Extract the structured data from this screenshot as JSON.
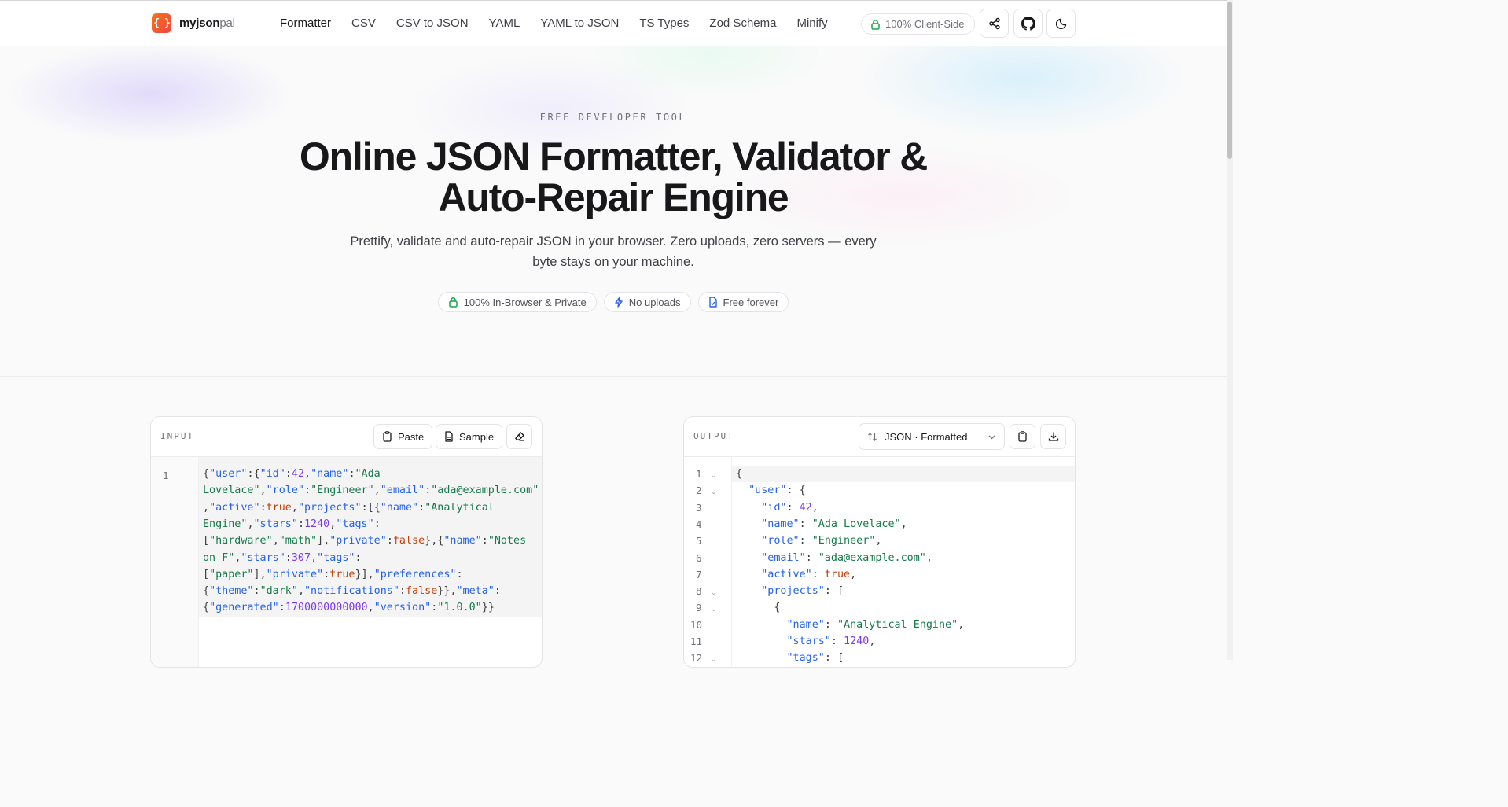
{
  "brand": {
    "name_bold": "myjson",
    "name_light": "pal"
  },
  "nav": {
    "items": [
      "Formatter",
      "CSV",
      "CSV to JSON",
      "YAML",
      "YAML to JSON",
      "TS Types",
      "Zod Schema",
      "Minify"
    ],
    "active": "Formatter"
  },
  "header_badge": "100% Client-Side",
  "header_icons": [
    "share-icon",
    "github-icon",
    "moon-icon"
  ],
  "hero": {
    "eyebrow": "FREE DEVELOPER TOOL",
    "title_line1": "Online JSON Formatter, Validator &",
    "title_line2": "Auto-Repair Engine",
    "subtitle": "Prettify, validate and auto-repair JSON in your browser. Zero uploads, zero servers — every byte stays on your machine.",
    "badges": [
      {
        "icon": "lock-icon",
        "label": "100% In-Browser & Private"
      },
      {
        "icon": "bolt-icon",
        "label": "No uploads"
      },
      {
        "icon": "file-icon",
        "label": "Free forever"
      }
    ]
  },
  "input_panel": {
    "label": "INPUT",
    "paste_label": "Paste",
    "sample_label": "Sample",
    "line_numbers": [
      "1"
    ],
    "wrapped_lines": [
      "{\"user\":{\"id\":42,\"name\":\"Ada",
      "Lovelace\",\"role\":\"Engineer\",\"email\":\"ada@example.com\"",
      ",\"active\":true,\"projects\":[{\"name\":\"Analytical",
      "Engine\",\"stars\":1240,\"tags\":",
      "[\"hardware\",\"math\"],\"private\":false},{\"name\":\"Notes",
      "on F\",\"stars\":307,\"tags\":",
      "[\"paper\"],\"private\":true}],\"preferences\":",
      "{\"theme\":\"dark\",\"notifications\":false}},\"meta\":",
      "{\"generated\":1700000000000,\"version\":\"1.0.0\"}}"
    ]
  },
  "output_panel": {
    "label": "OUTPUT",
    "format_select": "JSON · Formatted",
    "lines": [
      {
        "num": "1",
        "fold": true,
        "text": "{"
      },
      {
        "num": "2",
        "fold": true,
        "text": "  \"user\": {"
      },
      {
        "num": "3",
        "fold": false,
        "text": "    \"id\": 42,"
      },
      {
        "num": "4",
        "fold": false,
        "text": "    \"name\": \"Ada Lovelace\","
      },
      {
        "num": "5",
        "fold": false,
        "text": "    \"role\": \"Engineer\","
      },
      {
        "num": "6",
        "fold": false,
        "text": "    \"email\": \"ada@example.com\","
      },
      {
        "num": "7",
        "fold": false,
        "text": "    \"active\": true,"
      },
      {
        "num": "8",
        "fold": true,
        "text": "    \"projects\": ["
      },
      {
        "num": "9",
        "fold": true,
        "text": "      {"
      },
      {
        "num": "10",
        "fold": false,
        "text": "        \"name\": \"Analytical Engine\","
      },
      {
        "num": "11",
        "fold": false,
        "text": "        \"stars\": 1240,"
      },
      {
        "num": "12",
        "fold": true,
        "text": "        \"tags\": ["
      }
    ]
  },
  "colors": {
    "key": "#2563eb",
    "string": "#16794b",
    "number": "#7c3aed",
    "boolean": "#c2410c",
    "brand_gradient_start": "#f97316",
    "brand_gradient_end": "#ef4444",
    "lock_green": "#16a34a",
    "accent_blue": "#2563eb"
  }
}
